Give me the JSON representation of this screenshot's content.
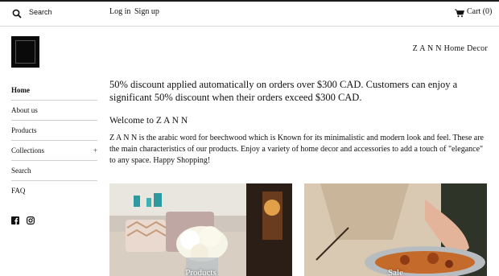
{
  "header": {
    "search_label": "Search",
    "login_label": "Log in",
    "signup_label": "Sign up",
    "cart_label": "Cart (0)"
  },
  "brand": "Z A N N  Home Decor",
  "sidebar": {
    "items": [
      {
        "label": "Home"
      },
      {
        "label": "About us"
      },
      {
        "label": "Products"
      },
      {
        "label": "Collections",
        "expander": "+"
      },
      {
        "label": "Search"
      },
      {
        "label": "FAQ"
      }
    ],
    "social": [
      "facebook-icon",
      "instagram-icon"
    ]
  },
  "main": {
    "promo": "50% discount applied automatically on orders over $300 CAD. Customers can enjoy a significant 50% discount when their orders exceed $300 CAD.",
    "welcome": "Welcome to Z A N N",
    "body": "Z A N N is the arabic word for beechwood which is Known for its minimalistic and modern look and feel.  These are the main characteristics of our products.  Enjoy a variety of home decor and accessories to add a touch of \"elegance\" to any space. Happy Shopping!"
  },
  "cards": [
    {
      "label": "Products"
    },
    {
      "label": "Sale"
    }
  ],
  "colors": {
    "topline": "#1c1c1c",
    "text": "#111111",
    "divider": "#cfcfcf"
  }
}
